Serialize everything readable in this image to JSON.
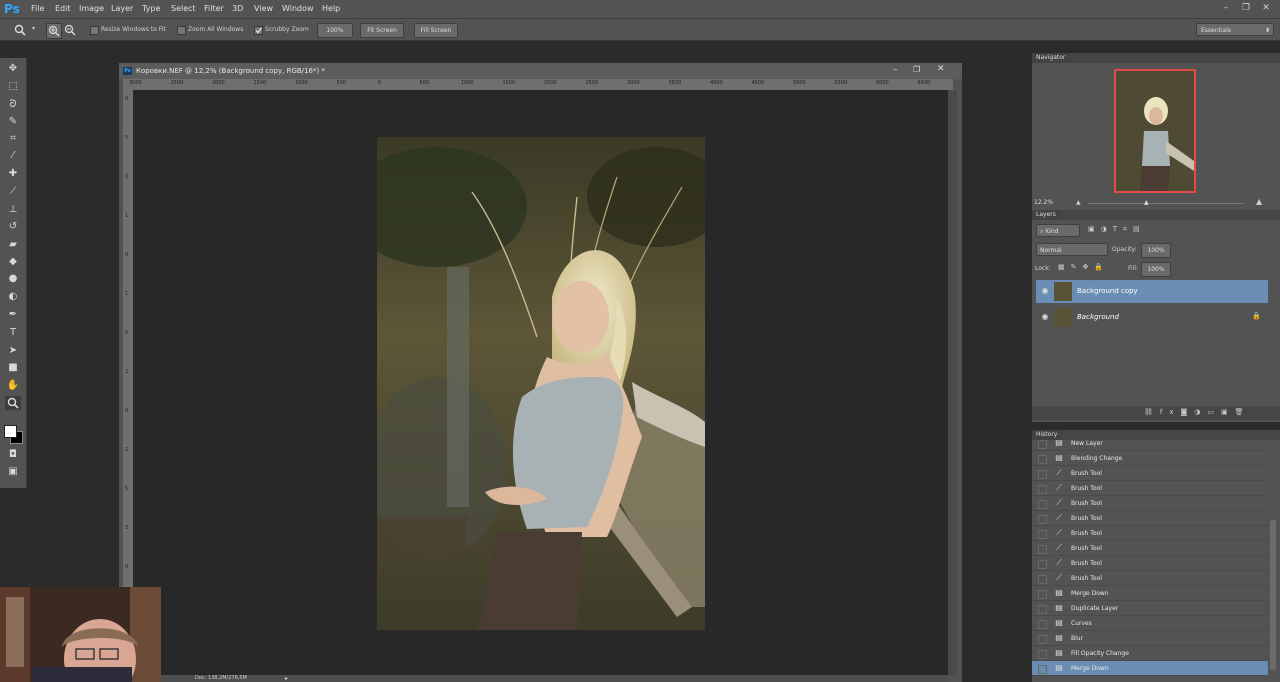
{
  "app": {
    "logo": "Ps",
    "menus": [
      "File",
      "Edit",
      "Image",
      "Layer",
      "Type",
      "Select",
      "Filter",
      "3D",
      "View",
      "Window",
      "Help"
    ],
    "window_controls": [
      "–",
      "❐",
      "✕"
    ]
  },
  "options_bar": {
    "tool_icon": "zoom-icon",
    "resize_windows_label": "Resize Windows to Fit",
    "zoom_all_windows_label": "Zoom All Windows",
    "scrubby_zoom_label": "Scrubby Zoom",
    "zoom_btn_label": "100%",
    "fit_screen_label": "Fit Screen",
    "fill_screen_label": "Fill Screen",
    "workspace_value": "Essentials"
  },
  "document": {
    "title": "Коровки.NEF @ 12,2% (Background copy, RGB/16*) *",
    "ruler_top_labels": [
      "3000",
      "2500",
      "2000",
      "1500",
      "1000",
      "500",
      "0",
      "500",
      "1000",
      "1500",
      "2000",
      "2500",
      "3000",
      "3500",
      "4000",
      "4500",
      "5000",
      "5500",
      "6000",
      "6500"
    ],
    "ruler_left_labels": [
      "0",
      "5",
      "0",
      "1",
      "0",
      "1",
      "5",
      "2",
      "0",
      "2",
      "5",
      "3",
      "0",
      "3",
      "5"
    ],
    "status": "Doc: 138,2M/276,5M"
  },
  "navigator": {
    "tab_label": "Navigator",
    "zoom_value": "12.2%"
  },
  "layers": {
    "tab_label": "Layers",
    "kind_label": "Kind",
    "blend_mode": "Normal",
    "opacity_label": "Opacity:",
    "opacity_value": "100%",
    "lock_label": "Lock:",
    "fill_label": "Fill:",
    "fill_value": "100%",
    "items": [
      {
        "name": "Background copy",
        "selected": true
      },
      {
        "name": "Background",
        "selected": false
      }
    ]
  },
  "history": {
    "tab_label": "History",
    "items": [
      {
        "label": "New Layer",
        "icon": "doc"
      },
      {
        "label": "Blending Change",
        "icon": "doc"
      },
      {
        "label": "Brush Tool",
        "icon": "brush"
      },
      {
        "label": "Brush Tool",
        "icon": "brush"
      },
      {
        "label": "Brush Tool",
        "icon": "brush"
      },
      {
        "label": "Brush Tool",
        "icon": "brush"
      },
      {
        "label": "Brush Tool",
        "icon": "brush"
      },
      {
        "label": "Brush Tool",
        "icon": "brush"
      },
      {
        "label": "Brush Tool",
        "icon": "brush"
      },
      {
        "label": "Brush Tool",
        "icon": "brush"
      },
      {
        "label": "Merge Down",
        "icon": "doc"
      },
      {
        "label": "Duplicate Layer",
        "icon": "doc"
      },
      {
        "label": "Curves",
        "icon": "doc"
      },
      {
        "label": "Blur",
        "icon": "doc"
      },
      {
        "label": "Fill Opacity Change",
        "icon": "doc"
      },
      {
        "label": "Merge Down",
        "icon": "doc",
        "selected": true
      }
    ]
  },
  "colors": {
    "accent_selection": "#6a8db4",
    "nav_frame": "#e34a48"
  }
}
